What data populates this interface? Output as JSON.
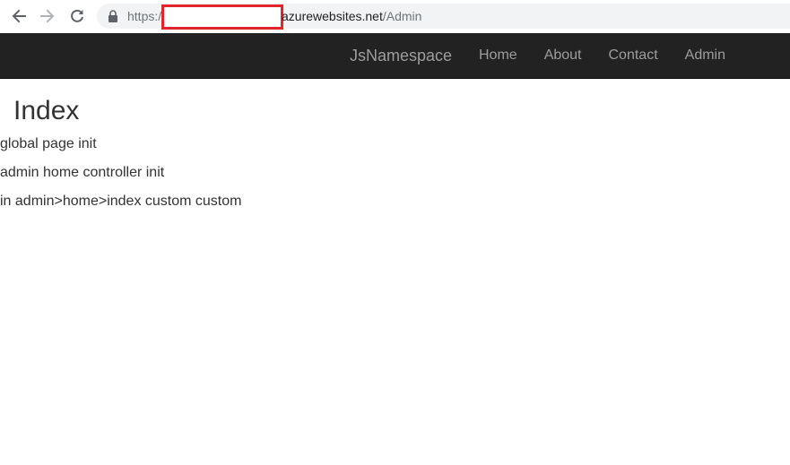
{
  "browser": {
    "url_scheme": "https:/",
    "url_host": "azurewebsites.net",
    "url_path": "/Admin",
    "icons": {
      "back": "arrow-left-icon",
      "forward": "arrow-right-icon",
      "reload": "reload-icon",
      "security": "lock-icon"
    }
  },
  "navbar": {
    "brand": "JsNamespace",
    "links": [
      "Home",
      "About",
      "Contact",
      "Admin"
    ],
    "colors": {
      "background": "#222222",
      "text": "#9d9d9d"
    }
  },
  "main": {
    "title": "Index",
    "lines": [
      "global page init",
      "admin home controller init",
      "in admin>home>index custom custom"
    ]
  },
  "annotation": {
    "redaction_color": "#e0262c"
  }
}
